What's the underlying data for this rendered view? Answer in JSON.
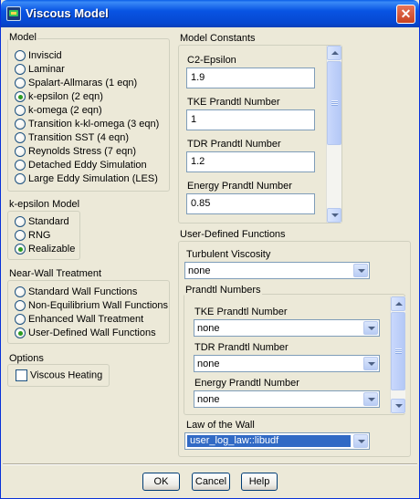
{
  "window": {
    "title": "Viscous Model"
  },
  "model": {
    "label": "Model",
    "options": [
      {
        "label": "Inviscid",
        "checked": false
      },
      {
        "label": "Laminar",
        "checked": false
      },
      {
        "label": "Spalart-Allmaras (1 eqn)",
        "checked": false
      },
      {
        "label": "k-epsilon (2 eqn)",
        "checked": true
      },
      {
        "label": "k-omega (2 eqn)",
        "checked": false
      },
      {
        "label": "Transition k-kl-omega (3 eqn)",
        "checked": false
      },
      {
        "label": "Transition SST (4 eqn)",
        "checked": false
      },
      {
        "label": "Reynolds Stress (7 eqn)",
        "checked": false
      },
      {
        "label": "Detached Eddy Simulation",
        "checked": false
      },
      {
        "label": "Large Eddy Simulation (LES)",
        "checked": false
      }
    ]
  },
  "kepsilon": {
    "label": "k-epsilon Model",
    "options": [
      {
        "label": "Standard",
        "checked": false
      },
      {
        "label": "RNG",
        "checked": false
      },
      {
        "label": "Realizable",
        "checked": true
      }
    ]
  },
  "nearwall": {
    "label": "Near-Wall Treatment",
    "options": [
      {
        "label": "Standard Wall Functions",
        "checked": false
      },
      {
        "label": "Non-Equilibrium Wall Functions",
        "checked": false
      },
      {
        "label": "Enhanced Wall Treatment",
        "checked": false
      },
      {
        "label": "User-Defined Wall Functions",
        "checked": true
      }
    ]
  },
  "options": {
    "label": "Options",
    "viscous_heating": {
      "label": "Viscous Heating",
      "checked": false
    }
  },
  "constants": {
    "label": "Model Constants",
    "fields": [
      {
        "label": "C2-Epsilon",
        "value": "1.9"
      },
      {
        "label": "TKE Prandtl Number",
        "value": "1"
      },
      {
        "label": "TDR Prandtl Number",
        "value": "1.2"
      },
      {
        "label": "Energy Prandtl Number",
        "value": "0.85"
      }
    ]
  },
  "udf": {
    "label": "User-Defined Functions",
    "turbulent_viscosity": {
      "label": "Turbulent Viscosity",
      "value": "none"
    },
    "prandtl": {
      "label": "Prandtl Numbers",
      "fields": [
        {
          "label": "TKE Prandtl Number",
          "value": "none"
        },
        {
          "label": "TDR Prandtl Number",
          "value": "none"
        },
        {
          "label": "Energy Prandtl Number",
          "value": "none"
        }
      ]
    },
    "law_of_wall": {
      "label": "Law of the Wall",
      "value": "user_log_law::libudf"
    }
  },
  "buttons": {
    "ok": "OK",
    "cancel": "Cancel",
    "help": "Help"
  },
  "icons": {
    "app": "fluent-app-icon",
    "close": "close-icon"
  }
}
